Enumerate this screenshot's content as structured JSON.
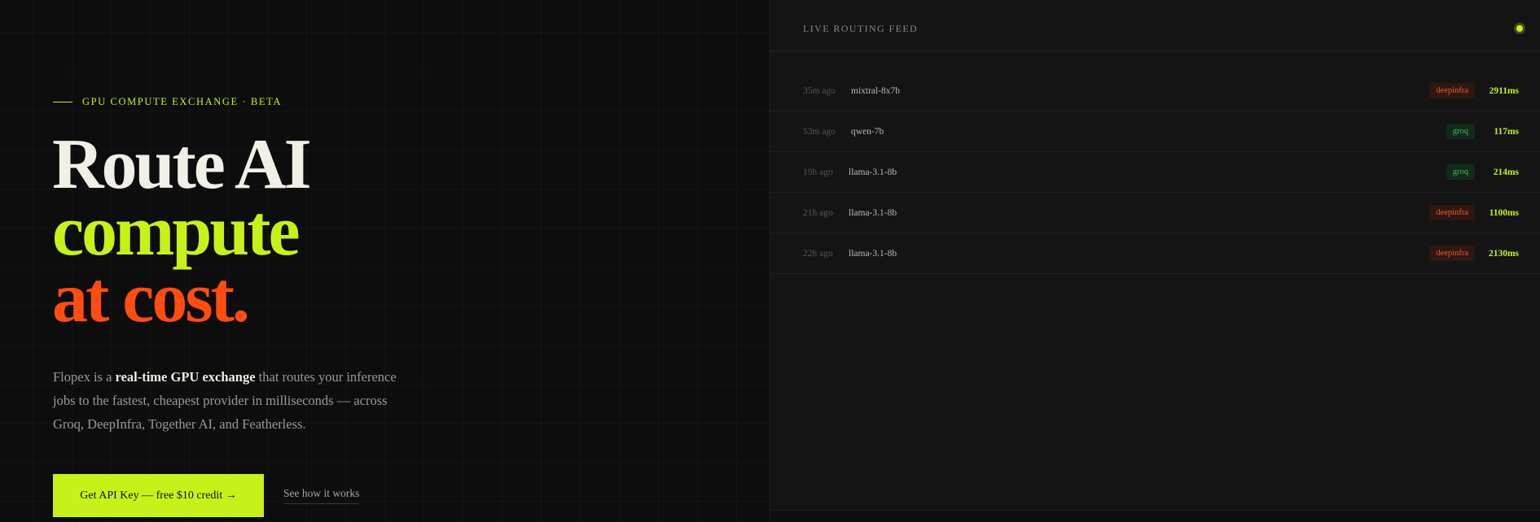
{
  "hero": {
    "eyebrow": "GPU COMPUTE EXCHANGE · BETA",
    "headline_line1": "Route AI",
    "headline_line2": "compute",
    "headline_line3": "at cost.",
    "desc_part1": "Flopex is a ",
    "desc_bold": "real-time GPU exchange",
    "desc_part2": " that routes your inference jobs to the fastest, cheapest provider in milliseconds — across Groq, DeepInfra, Together AI, and Featherless.",
    "cta_label": "Get API Key — free $10 credit →",
    "secondary_label": "See how it works"
  },
  "feed": {
    "title": "LIVE ROUTING FEED",
    "rows": [
      {
        "time": "35m ago",
        "model": "mixtral-8x7b",
        "provider": "deepinfra",
        "latency": "2911ms"
      },
      {
        "time": "53m ago",
        "model": "qwen-7b",
        "provider": "groq",
        "latency": "117ms"
      },
      {
        "time": "19h ago",
        "model": "llama-3.1-8b",
        "provider": "groq",
        "latency": "214ms"
      },
      {
        "time": "21h ago",
        "model": "llama-3.1-8b",
        "provider": "deepinfra",
        "latency": "1100ms"
      },
      {
        "time": "22h ago",
        "model": "llama-3.1-8b",
        "provider": "deepinfra",
        "latency": "2130ms"
      }
    ]
  },
  "colors": {
    "accent_lime": "#c6f21a",
    "accent_orange": "#ff4d12",
    "background": "#0d0d0d",
    "panel": "#141414"
  }
}
